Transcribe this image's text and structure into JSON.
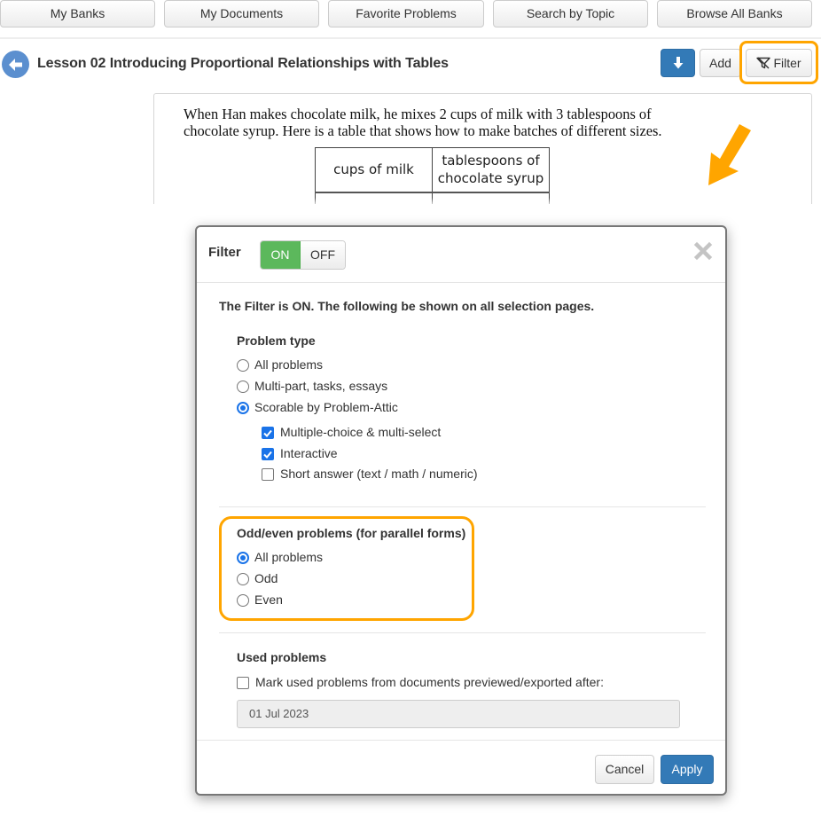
{
  "topnav": {
    "items": [
      {
        "label": "My Banks"
      },
      {
        "label": "My Documents"
      },
      {
        "label": "Favorite Problems"
      },
      {
        "label": "Search by Topic"
      },
      {
        "label": "Browse All Banks"
      }
    ]
  },
  "header": {
    "back_icon": "arrow-left-circle-icon",
    "title": "Lesson 02 Introducing Proportional Relationships with Tables",
    "download_icon": "arrow-down-icon",
    "add_label": "Add",
    "filter_icon": "filter-icon",
    "filter_label": "Filter"
  },
  "problem": {
    "text_line1": "When Han makes chocolate milk, he mixes 2 cups of milk with 3 tablespoons of",
    "text_line2": "chocolate syrup.  Here is a table that shows how to make batches of different sizes.",
    "table": {
      "headers": [
        "cups of milk",
        "tablespoons of chocolate syrup"
      ]
    }
  },
  "annotations": {
    "highlight_color": "#ffa500",
    "arrow_icon": "arrow-down-left-icon"
  },
  "modal": {
    "title": "Filter",
    "toggle": {
      "on_label": "ON",
      "off_label": "OFF",
      "selected": "ON",
      "on_color": "#5cb85c"
    },
    "close_icon": "close-icon",
    "status_text": "The Filter is ON. The following be shown on all selection pages.",
    "problem_type": {
      "heading": "Problem type",
      "options": [
        {
          "label": "All problems",
          "checked": false
        },
        {
          "label": "Multi-part, tasks, essays",
          "checked": false
        },
        {
          "label": "Scorable by Problem-Attic",
          "checked": true
        }
      ],
      "sub_options": [
        {
          "label": "Multiple-choice & multi-select",
          "checked": true
        },
        {
          "label": "Interactive",
          "checked": true
        },
        {
          "label": "Short answer (text / math / numeric)",
          "checked": false
        }
      ]
    },
    "odd_even": {
      "heading": "Odd/even problems (for parallel forms)",
      "options": [
        {
          "label": "All problems",
          "checked": true
        },
        {
          "label": "Odd",
          "checked": false
        },
        {
          "label": "Even",
          "checked": false
        }
      ]
    },
    "used": {
      "heading": "Used problems",
      "checkbox_label": "Mark used problems from documents previewed/exported after:",
      "checked": false,
      "date_value": "01 Jul 2023"
    },
    "footer": {
      "cancel_label": "Cancel",
      "apply_label": "Apply",
      "apply_color": "#337ab7"
    }
  }
}
